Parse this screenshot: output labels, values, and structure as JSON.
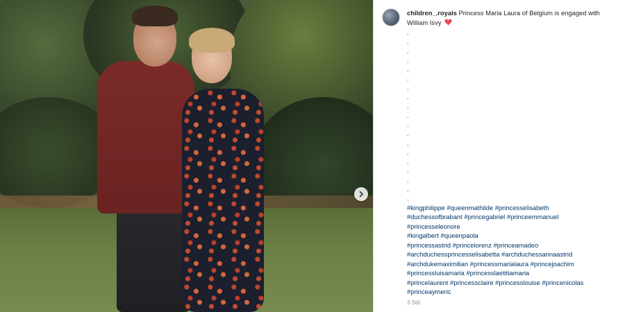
{
  "post": {
    "username": "children_.royals",
    "caption": "Princess Maria Laura of Belgium is engaged with William Isvy",
    "caption_emoji": "red-heart-icon",
    "dot_lines": [
      ".",
      ".",
      ".",
      ".",
      ".",
      ".",
      ".",
      ".",
      ".",
      ".",
      ".",
      ".",
      ".",
      ".",
      ".",
      ".",
      ".",
      ".",
      "."
    ],
    "hashtag_lines": [
      [
        "#kingphilippe",
        "#queenmathilde",
        "#princesselisabeth"
      ],
      [
        "#duchessofbrabant",
        "#princegabriel",
        "#princeemmanuel"
      ],
      [
        "#princesseleonore"
      ],
      [
        "#kingalbert",
        "#queenpaola"
      ],
      [
        "#princessastrid",
        "#princelorenz",
        "#princeamadeo"
      ],
      [
        "#archduchessprincesselisabetta",
        "#archduchessannaastrid"
      ],
      [
        "#archdukemaximilian",
        "#princessmarialaura",
        "#princejoachim"
      ],
      [
        "#princessluisamaria",
        "#princesslaetitiamaria"
      ],
      [
        "#princelaurent",
        "#princessclaire",
        "#princesslouise",
        "#princenicolas"
      ],
      [
        "#princeaymeric"
      ]
    ],
    "timestamp": "3 Std."
  },
  "carousel": {
    "next_icon": "chevron-right-icon"
  },
  "colors": {
    "hashtag": "#00376b",
    "text": "#262626",
    "muted": "#8e8e8e",
    "heart": "#ed4956"
  }
}
